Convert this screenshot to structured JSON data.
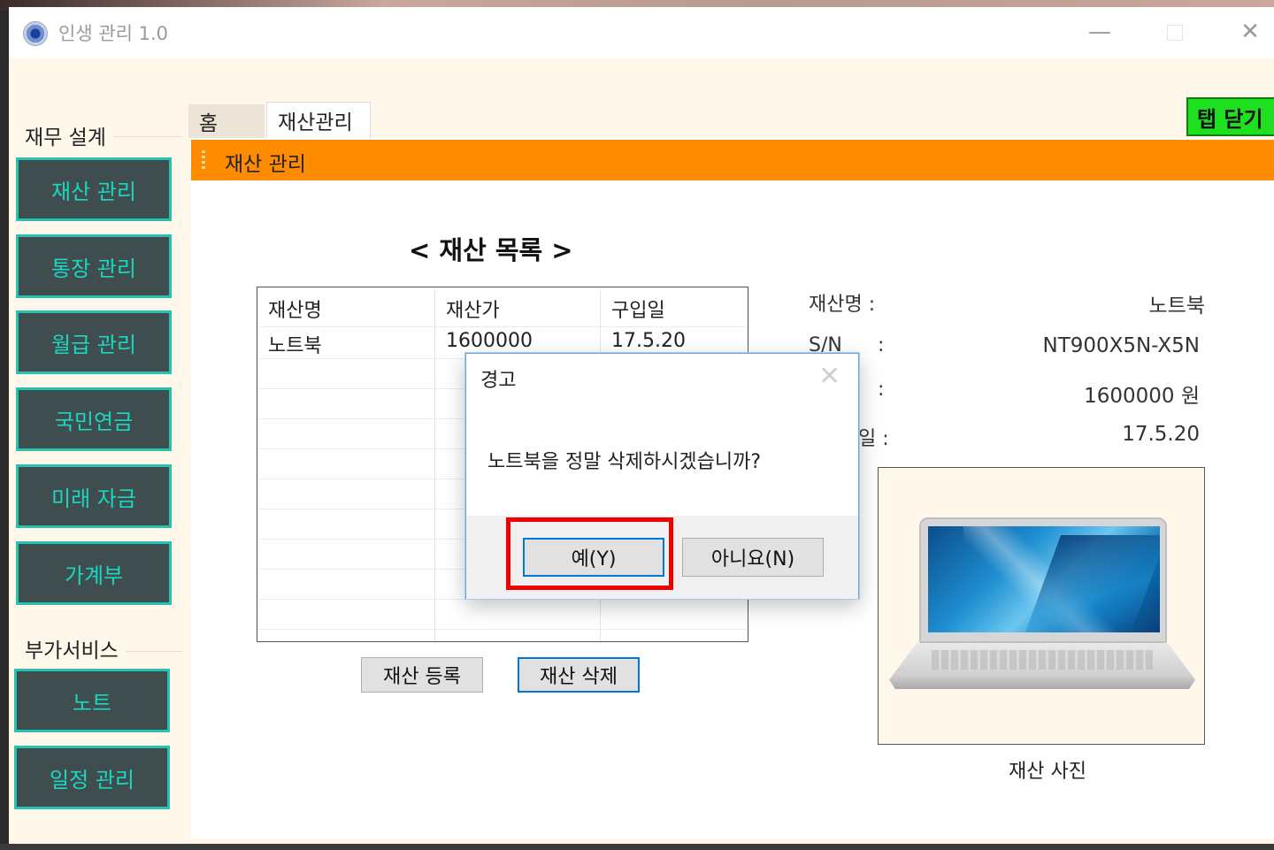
{
  "window": {
    "title": "인생 관리 1.0",
    "controls": {
      "minimize": "—",
      "close": "✕"
    }
  },
  "sidebar": {
    "finance_label": "재무 설계",
    "finance_items": [
      "재산 관리",
      "통장 관리",
      "월급 관리",
      "국민연금",
      "미래 자금",
      "가계부"
    ],
    "extra_label": "부가서비스",
    "extra_items": [
      "노트",
      "일정 관리"
    ]
  },
  "tabs": {
    "home": "홈",
    "asset": "재산관리",
    "close_tab": "탭 닫기"
  },
  "panel": {
    "header": "재산 관리",
    "list_title": "< 재산 목록 >",
    "table": {
      "columns": [
        "재산명",
        "재산가",
        "구입일"
      ],
      "rows": [
        {
          "name": "노트북",
          "price": "1600000",
          "date": "17.5.20"
        }
      ]
    },
    "buttons": {
      "register": "재산 등록",
      "delete": "재산 삭제"
    },
    "details": {
      "name_label": "재산명 :",
      "name_value": "노트북",
      "sn_label": "S/N",
      "sn_colon": ":",
      "sn_value": "NT900X5N-X5N",
      "price_colon": ":",
      "price_value": "1600000 원",
      "date_label_partial": "일 :",
      "date_value": "17.5.20",
      "photo_caption": "재산 사진"
    }
  },
  "dialog": {
    "title": "경고",
    "close": "✕",
    "message": "노트북을 정말 삭제하시겠습니까?",
    "yes": "예(Y)",
    "no": "아니요(N)"
  },
  "colors": {
    "accent_orange": "#ff8c00",
    "sidebar_button_bg": "#3f4d4f",
    "sidebar_button_text": "#1ad7c2",
    "close_tab_green": "#1fe01f",
    "highlight_red": "#ee0000",
    "focus_blue": "#0078d7"
  }
}
